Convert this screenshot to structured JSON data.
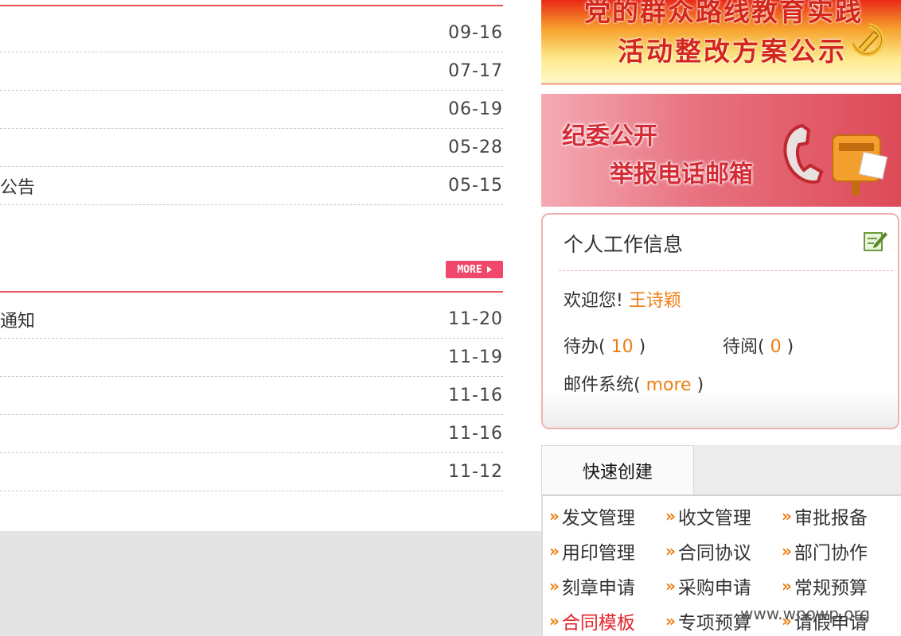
{
  "news_list_1": [
    {
      "title": "",
      "date": "09-16"
    },
    {
      "title": "",
      "date": "07-17"
    },
    {
      "title": "",
      "date": "06-19"
    },
    {
      "title": "",
      "date": "05-28"
    },
    {
      "title": "公告",
      "date": "05-15"
    }
  ],
  "news_list_2": [
    {
      "title": "通知",
      "date": "11-20"
    },
    {
      "title": "",
      "date": "11-19"
    },
    {
      "title": "",
      "date": "11-16"
    },
    {
      "title": "",
      "date": "11-16"
    },
    {
      "title": "",
      "date": "11-12"
    }
  ],
  "more_label": "MORE",
  "banner1": {
    "line1": "党的群众路线教育实践",
    "line2": "活动整改方案公示"
  },
  "banner2": {
    "line1": "纪委公开",
    "line2": "举报电话邮箱"
  },
  "work_info": {
    "title": "个人工作信息",
    "welcome_label": "欢迎您!",
    "user_name": "王诗颖",
    "todo_label": "待办(",
    "todo_count": "10",
    "toread_label": "待阅(",
    "toread_count": "0",
    "paren_close": ")",
    "mail_label": "邮件系统(",
    "mail_link": "more"
  },
  "quick_create": {
    "tab_label": "快速创建",
    "items": [
      "发文管理",
      "收文管理",
      "审批报备",
      "用印管理",
      "合同协议",
      "部门协作",
      "刻章申请",
      "采购申请",
      "常规预算",
      "合同模板",
      "专项预算",
      "请假申请"
    ]
  },
  "watermark": "www.wpowp.org",
  "colors": {
    "accent_red": "#e8545a",
    "link_orange": "#ee7d11",
    "highlight_red": "#e3242b"
  }
}
